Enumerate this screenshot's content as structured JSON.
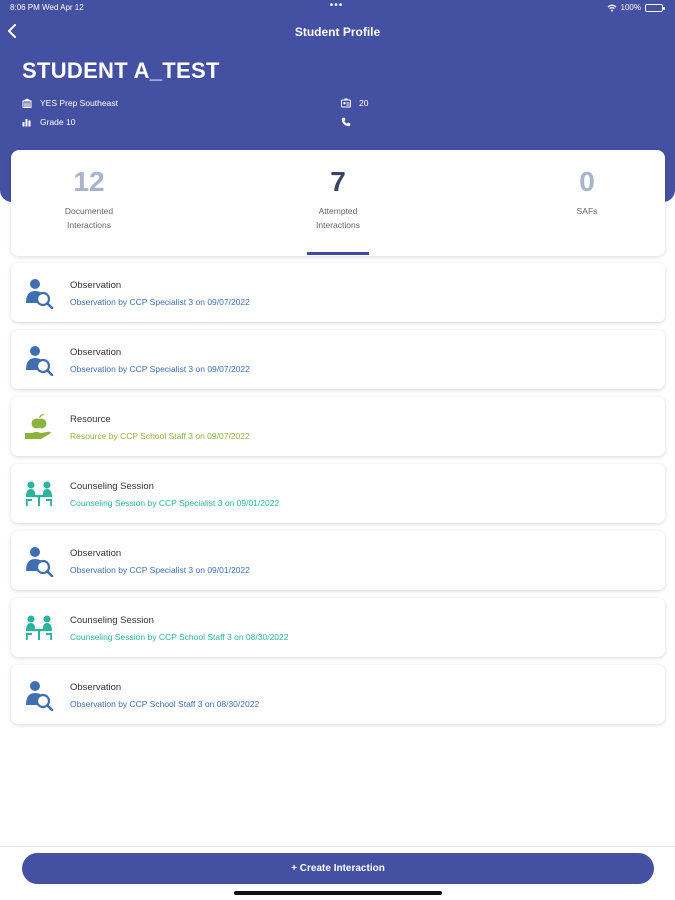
{
  "status_bar": {
    "time": "8:06 PM   Wed Apr 12",
    "dots": "•••",
    "battery": "100%"
  },
  "nav": {
    "title": "Student Profile"
  },
  "student": {
    "name": "STUDENT A_TEST",
    "school": "YES Prep Southeast",
    "grade": "Grade 10",
    "id_value": "20",
    "phone_value": ""
  },
  "stats": [
    {
      "value": "12",
      "label": "Documented\nInteractions",
      "active": false
    },
    {
      "value": "7",
      "label": "Attempted\nInteractions",
      "active": true
    },
    {
      "value": "0",
      "label": "SAFs",
      "active": false
    }
  ],
  "interactions": [
    {
      "type": "Observation",
      "detail": "Observation by CCP Specialist 3 on 09/07/2022",
      "icon": "observation-icon",
      "color": "#3f6fb0"
    },
    {
      "type": "Observation",
      "detail": "Observation by CCP Specialist 3 on 09/07/2022",
      "icon": "observation-icon",
      "color": "#3f6fb0"
    },
    {
      "type": "Resource",
      "detail": "Resource by CCP School Staff 3 on 09/07/2022",
      "icon": "resource-icon",
      "color": "#8cb43c"
    },
    {
      "type": "Counseling Session",
      "detail": "Counseling Session by CCP Specialist 3 on 09/01/2022",
      "icon": "counseling-icon",
      "color": "#2bb39b"
    },
    {
      "type": "Observation",
      "detail": "Observation by CCP Specialist 3 on 09/01/2022",
      "icon": "observation-icon",
      "color": "#3f6fb0"
    },
    {
      "type": "Counseling Session",
      "detail": "Counseling Session by CCP School Staff 3 on 08/30/2022",
      "icon": "counseling-icon",
      "color": "#2bb39b"
    },
    {
      "type": "Observation",
      "detail": "Observation by CCP School Staff 3 on 08/30/2022",
      "icon": "observation-icon",
      "color": "#3f6fb0"
    }
  ],
  "actions": {
    "create_label": "+ Create Interaction"
  },
  "colors": {
    "header": "#4451a3",
    "stat_inactive": "#a9b3cb",
    "stat_active": "#3a4566"
  }
}
